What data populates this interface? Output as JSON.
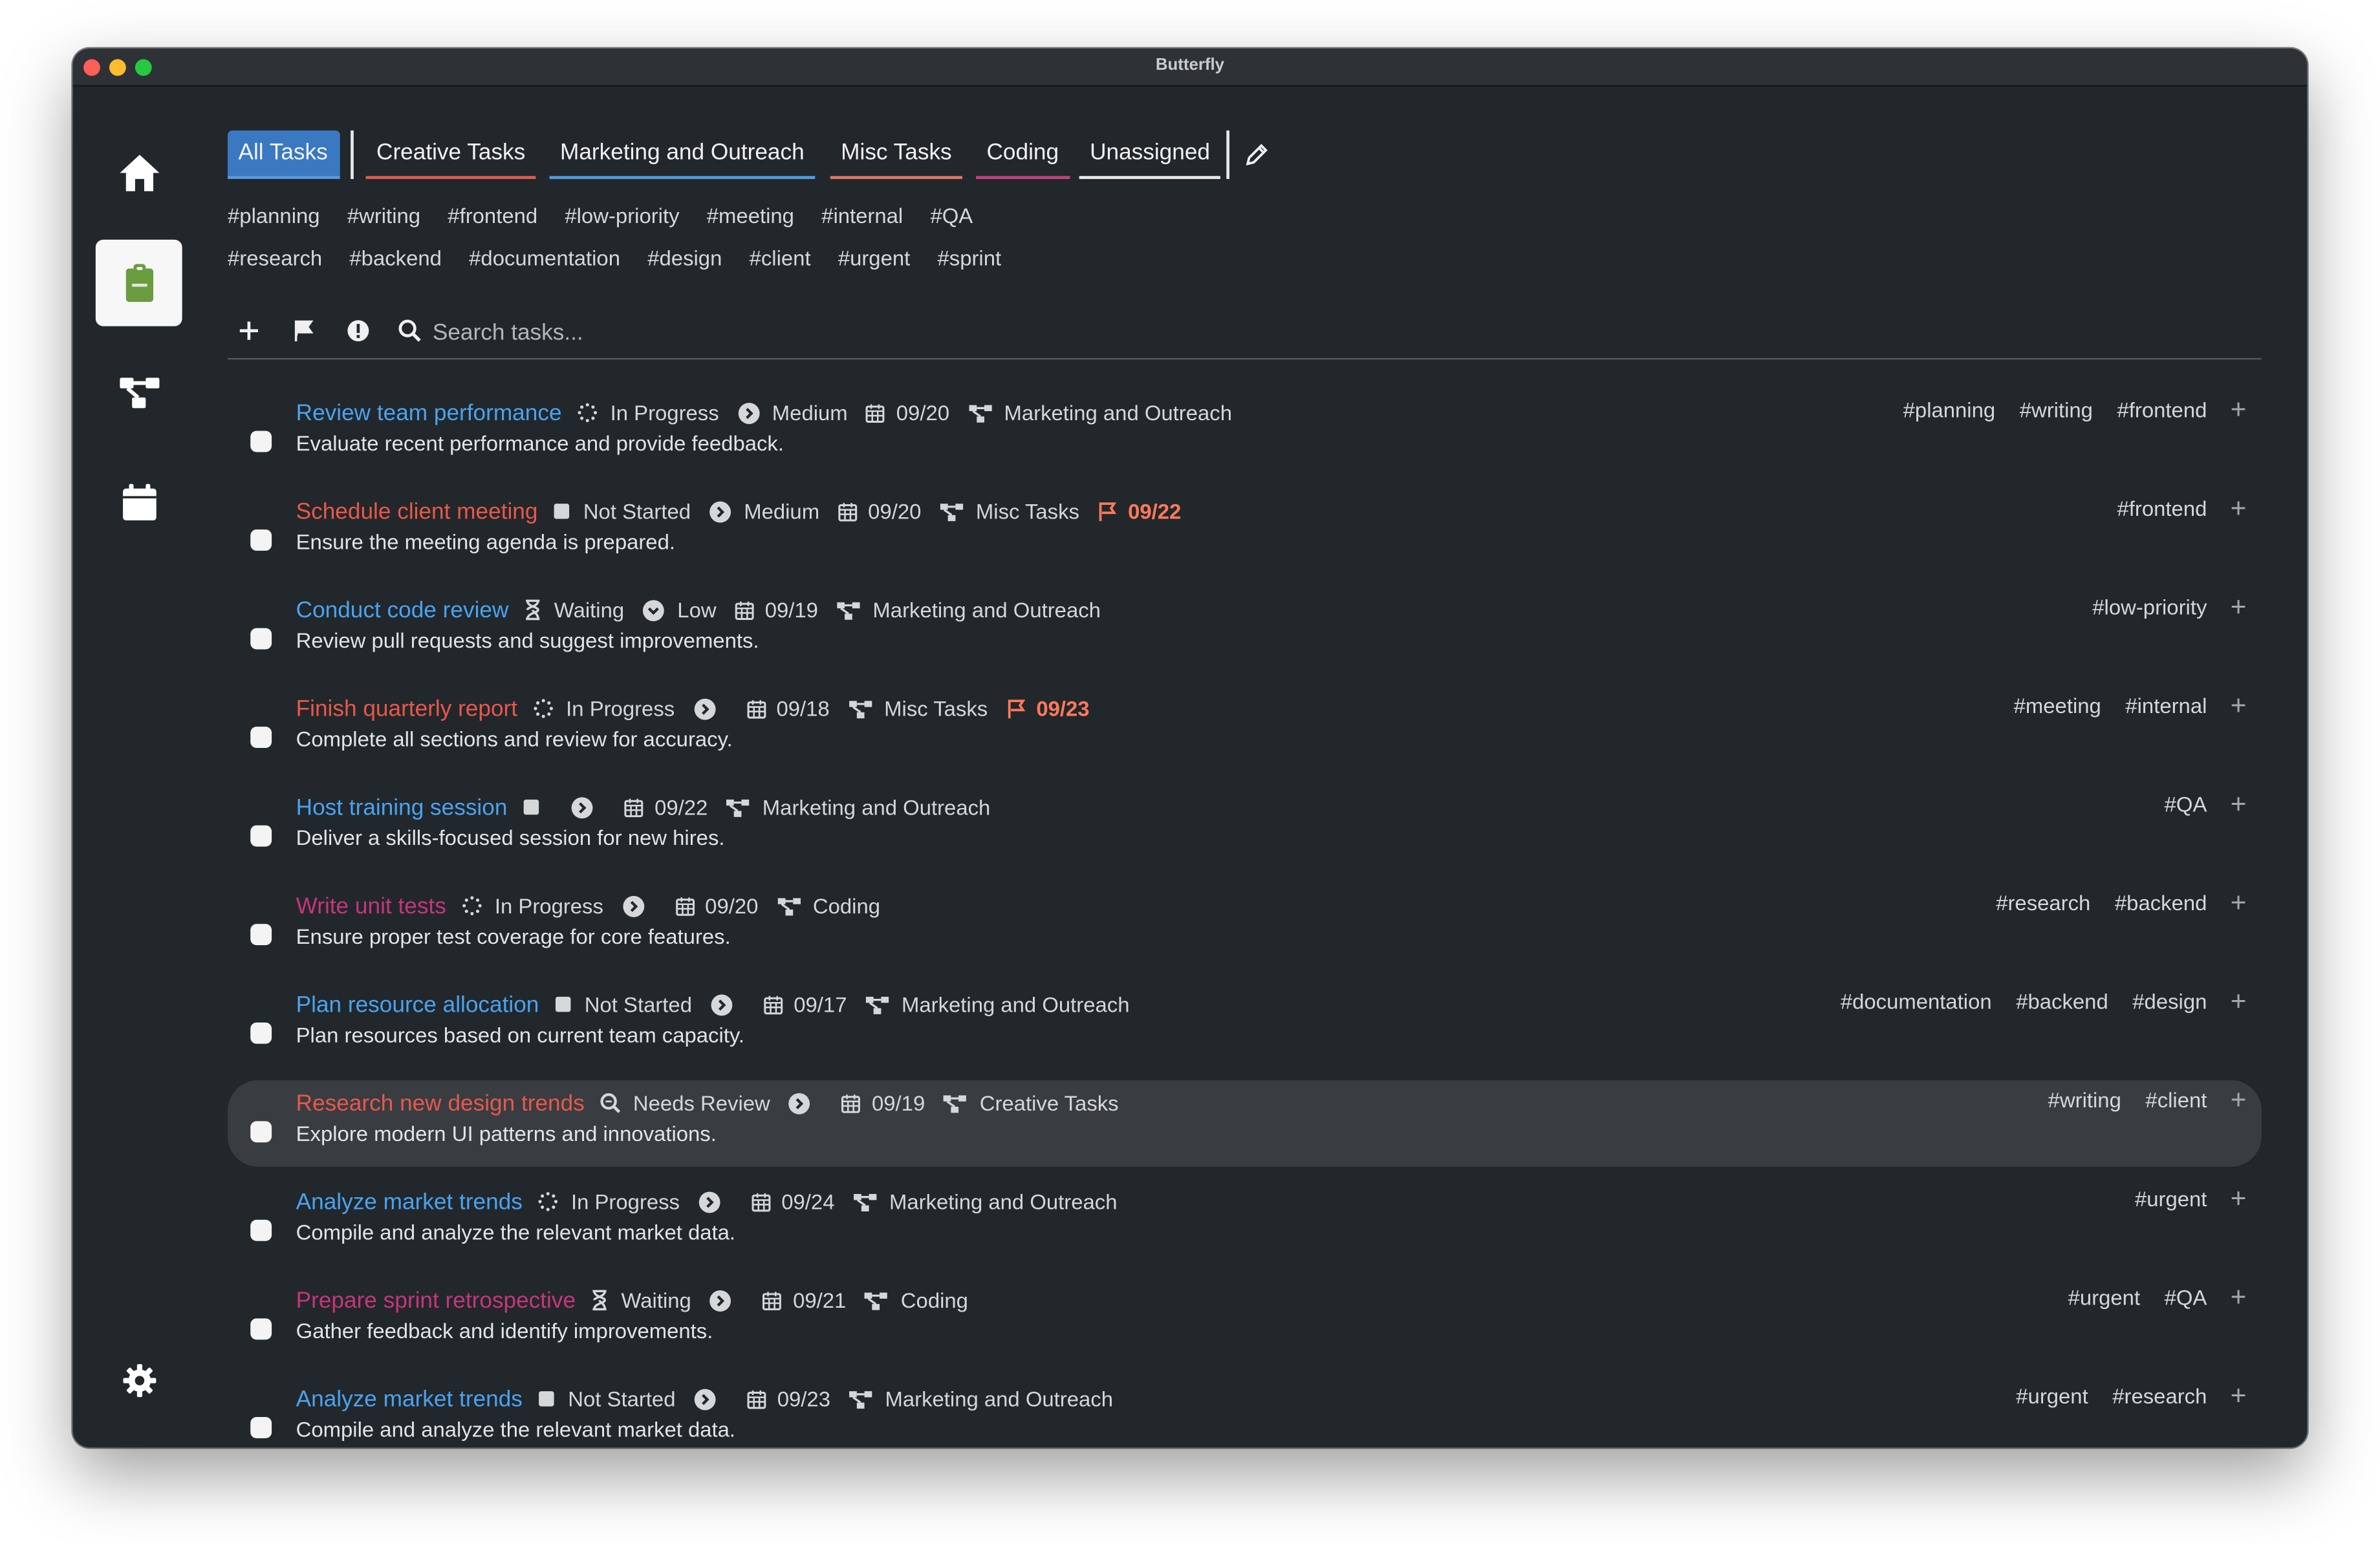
{
  "window": {
    "title": "Butterfly"
  },
  "sidebar": {
    "items": [
      {
        "icon": "home-icon"
      },
      {
        "icon": "clipboard-icon",
        "active": true
      },
      {
        "icon": "project-tree-icon"
      },
      {
        "icon": "calendar-icon"
      }
    ],
    "settings_icon": "gear-icon"
  },
  "tabs": [
    {
      "label": "All Tasks",
      "active": true,
      "underline": "#5b9be0"
    },
    {
      "label": "Creative Tasks",
      "underline": "#e05a4f"
    },
    {
      "label": "Marketing and Outreach",
      "underline": "#4f9be0"
    },
    {
      "label": "Misc Tasks",
      "underline": "#e07468"
    },
    {
      "label": "Coding",
      "underline": "#c4407f"
    },
    {
      "label": "Unassigned",
      "underline": "#e8e8e8"
    }
  ],
  "tags_row1": [
    "#planning",
    "#writing",
    "#frontend",
    "#low-priority",
    "#meeting",
    "#internal",
    "#QA"
  ],
  "tags_row2": [
    "#research",
    "#backend",
    "#documentation",
    "#design",
    "#client",
    "#urgent",
    "#sprint"
  ],
  "search": {
    "placeholder": "Search tasks..."
  },
  "colors": {
    "blue": "#4aa3f0",
    "red": "#e8584a",
    "pink": "#c7357b",
    "due": "#ff7a5c"
  },
  "tasks": [
    {
      "title": "Review team performance",
      "color": "#4aa3f0",
      "status": "In Progress",
      "status_icon": "spinner-icon",
      "priority": "Medium",
      "date": "09/20",
      "project": "Marketing and Outreach",
      "desc": "Evaluate recent performance and provide feedback.",
      "tags": [
        "#planning",
        "#writing",
        "#frontend"
      ]
    },
    {
      "title": "Schedule client meeting",
      "color": "#e8584a",
      "status": "Not Started",
      "status_icon": "square-icon",
      "priority": "Medium",
      "date": "09/20",
      "project": "Misc Tasks",
      "due": "09/22",
      "desc": "Ensure the meeting agenda is prepared.",
      "tags": [
        "#frontend"
      ]
    },
    {
      "title": "Conduct code review",
      "color": "#4aa3f0",
      "status": "Waiting",
      "status_icon": "hourglass-icon",
      "priority": "Low",
      "priority_icon": "chevron-down-circle-icon",
      "date": "09/19",
      "project": "Marketing and Outreach",
      "desc": "Review pull requests and suggest improvements.",
      "tags": [
        "#low-priority"
      ]
    },
    {
      "title": "Finish quarterly report",
      "color": "#e8584a",
      "status": "In Progress",
      "status_icon": "spinner-icon",
      "priority": "",
      "date": "09/18",
      "project": "Misc Tasks",
      "due": "09/23",
      "desc": "Complete all sections and review for accuracy.",
      "tags": [
        "#meeting",
        "#internal"
      ]
    },
    {
      "title": "Host training session",
      "color": "#4aa3f0",
      "status": "",
      "status_icon": "square-icon",
      "priority": "",
      "date": "09/22",
      "project": "Marketing and Outreach",
      "desc": "Deliver a skills-focused session for new hires.",
      "tags": [
        "#QA"
      ]
    },
    {
      "title": "Write unit tests",
      "color": "#c7357b",
      "status": "In Progress",
      "status_icon": "spinner-icon",
      "priority": "",
      "date": "09/20",
      "project": "Coding",
      "desc": "Ensure proper test coverage for core features.",
      "tags": [
        "#research",
        "#backend"
      ]
    },
    {
      "title": "Plan resource allocation",
      "color": "#4aa3f0",
      "status": "Not Started",
      "status_icon": "square-icon",
      "priority": "",
      "date": "09/17",
      "project": "Marketing and Outreach",
      "desc": "Plan resources based on current team capacity.",
      "tags": [
        "#documentation",
        "#backend",
        "#design"
      ]
    },
    {
      "title": "Research new design trends",
      "color": "#e8584a",
      "status": "Needs Review",
      "status_icon": "magnifier-icon",
      "priority": "",
      "date": "09/19",
      "project": "Creative Tasks",
      "desc": "Explore modern UI patterns and innovations.",
      "tags": [
        "#writing",
        "#client"
      ],
      "highlighted": true
    },
    {
      "title": "Analyze market trends",
      "color": "#4aa3f0",
      "status": "In Progress",
      "status_icon": "spinner-icon",
      "priority": "",
      "date": "09/24",
      "project": "Marketing and Outreach",
      "desc": "Compile and analyze the relevant market data.",
      "tags": [
        "#urgent"
      ]
    },
    {
      "title": "Prepare sprint retrospective",
      "color": "#c7357b",
      "status": "Waiting",
      "status_icon": "hourglass-icon",
      "priority": "",
      "date": "09/21",
      "project": "Coding",
      "desc": "Gather feedback and identify improvements.",
      "tags": [
        "#urgent",
        "#QA"
      ]
    },
    {
      "title": "Analyze market trends",
      "color": "#4aa3f0",
      "status": "Not Started",
      "status_icon": "square-icon",
      "priority": "",
      "date": "09/23",
      "project": "Marketing and Outreach",
      "desc": "Compile and analyze the relevant market data.",
      "tags": [
        "#urgent",
        "#research"
      ]
    }
  ]
}
